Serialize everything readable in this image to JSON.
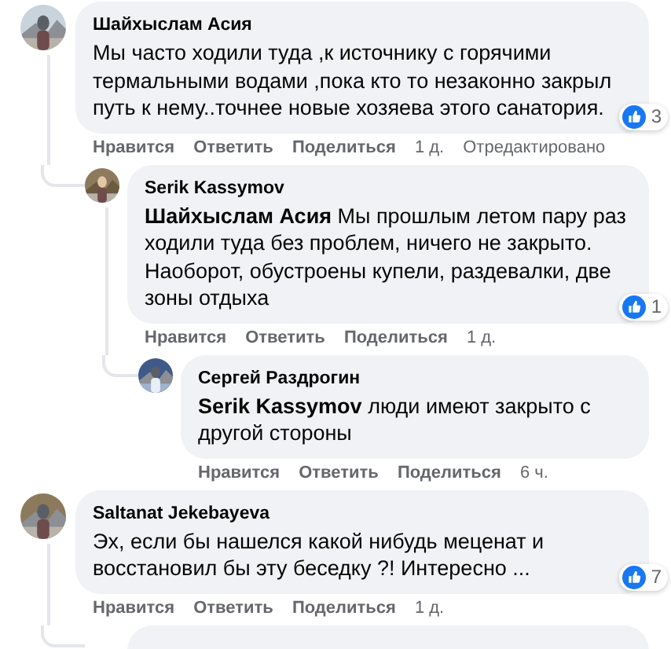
{
  "comments": [
    {
      "author": "Шайхыслам Асия",
      "text": "Мы часто ходили туда ,к источнику с горячими термальными водами ,пока кто то незаконно закрыл путь к нему..точнее новые хозяева этого санатория.",
      "reactions": "3",
      "actions": [
        "Нравится",
        "Ответить",
        "Поделиться"
      ],
      "time": "1 д.",
      "edited": "Отредактировано",
      "replies": [
        {
          "author": "Serik Kassymov",
          "text": "**Шайхыслам Асия** Мы прошлым летом пару раз ходили туда без проблем, ничего не закрыто. Наоборот, обустроены купели, раздевалки, две зоны отдыха",
          "reactions": "1",
          "actions": [
            "Нравится",
            "Ответить",
            "Поделиться"
          ],
          "time": "1 д.",
          "replies": [
            {
              "author": "Сергей Раздрогин",
              "text": "**Serik Kassymov** люди имеют закрыто с другой стороны",
              "actions": [
                "Нравится",
                "Ответить",
                "Поделиться"
              ],
              "time": "6 ч."
            }
          ]
        }
      ]
    },
    {
      "author": "Saltanat Jekebayeva",
      "text": "Эх, если бы нашелся какой нибудь меценат и восстановил бы эту беседку ?! Интересно ...",
      "reactions": "7",
      "actions": [
        "Нравится",
        "Ответить",
        "Поделиться"
      ],
      "time": "1 д.",
      "replies": [
        {
          "kind": "cut_off"
        }
      ]
    }
  ]
}
